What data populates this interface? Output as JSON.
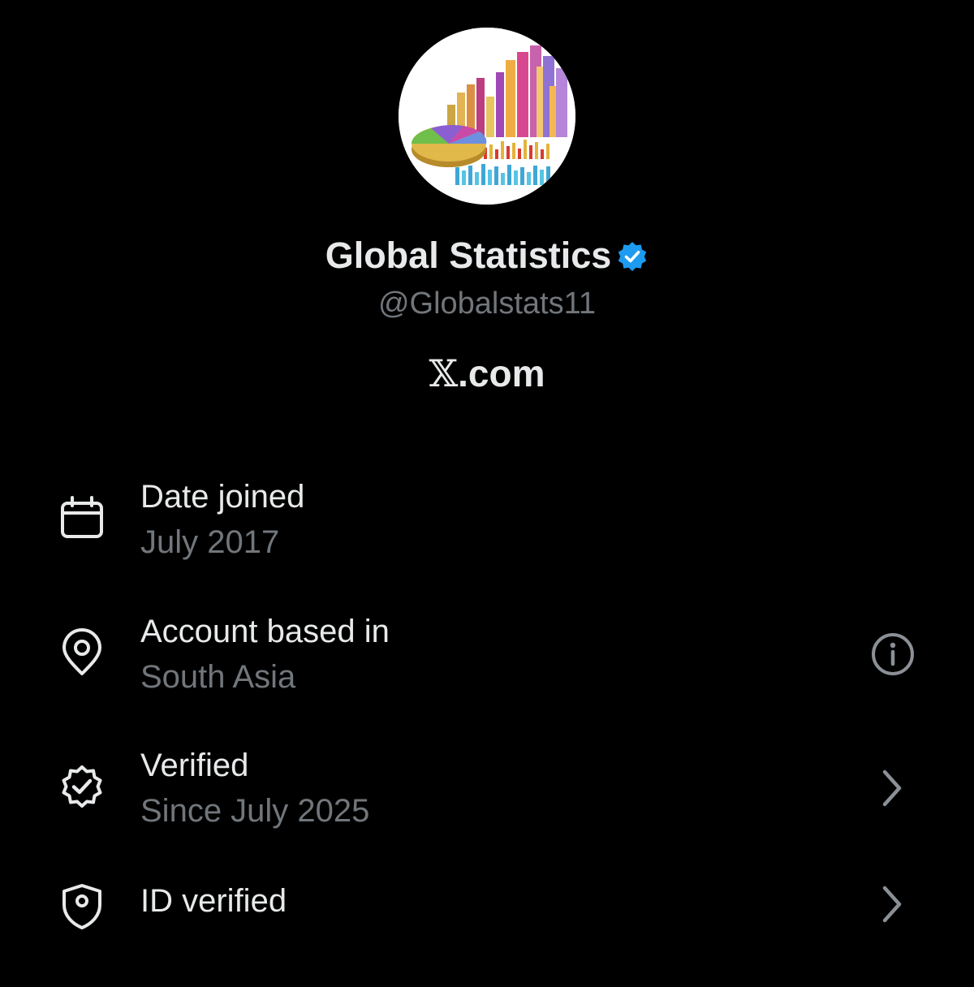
{
  "profile": {
    "display_name": "Global Statistics",
    "handle": "@Globalstats11",
    "site_x": "𝕏",
    "site_rest": ".com",
    "verified_badge_icon": "verified-badge-icon",
    "badge_color": "#1d9bf0"
  },
  "colors": {
    "background": "#000000",
    "primary_text": "#e7e9ea",
    "secondary_text": "#71767b"
  },
  "rows": [
    {
      "icon": "calendar-icon",
      "label": "Date joined",
      "value": "July 2017"
    },
    {
      "icon": "location-pin-icon",
      "label": "Account based in",
      "value": "South Asia",
      "action_icon": "info-icon"
    },
    {
      "icon": "verified-seal-icon",
      "label": "Verified",
      "value": "Since July 2025",
      "action_icon": "chevron-right-icon"
    },
    {
      "icon": "id-shield-icon",
      "label": "ID verified",
      "action_icon": "chevron-right-icon"
    }
  ]
}
